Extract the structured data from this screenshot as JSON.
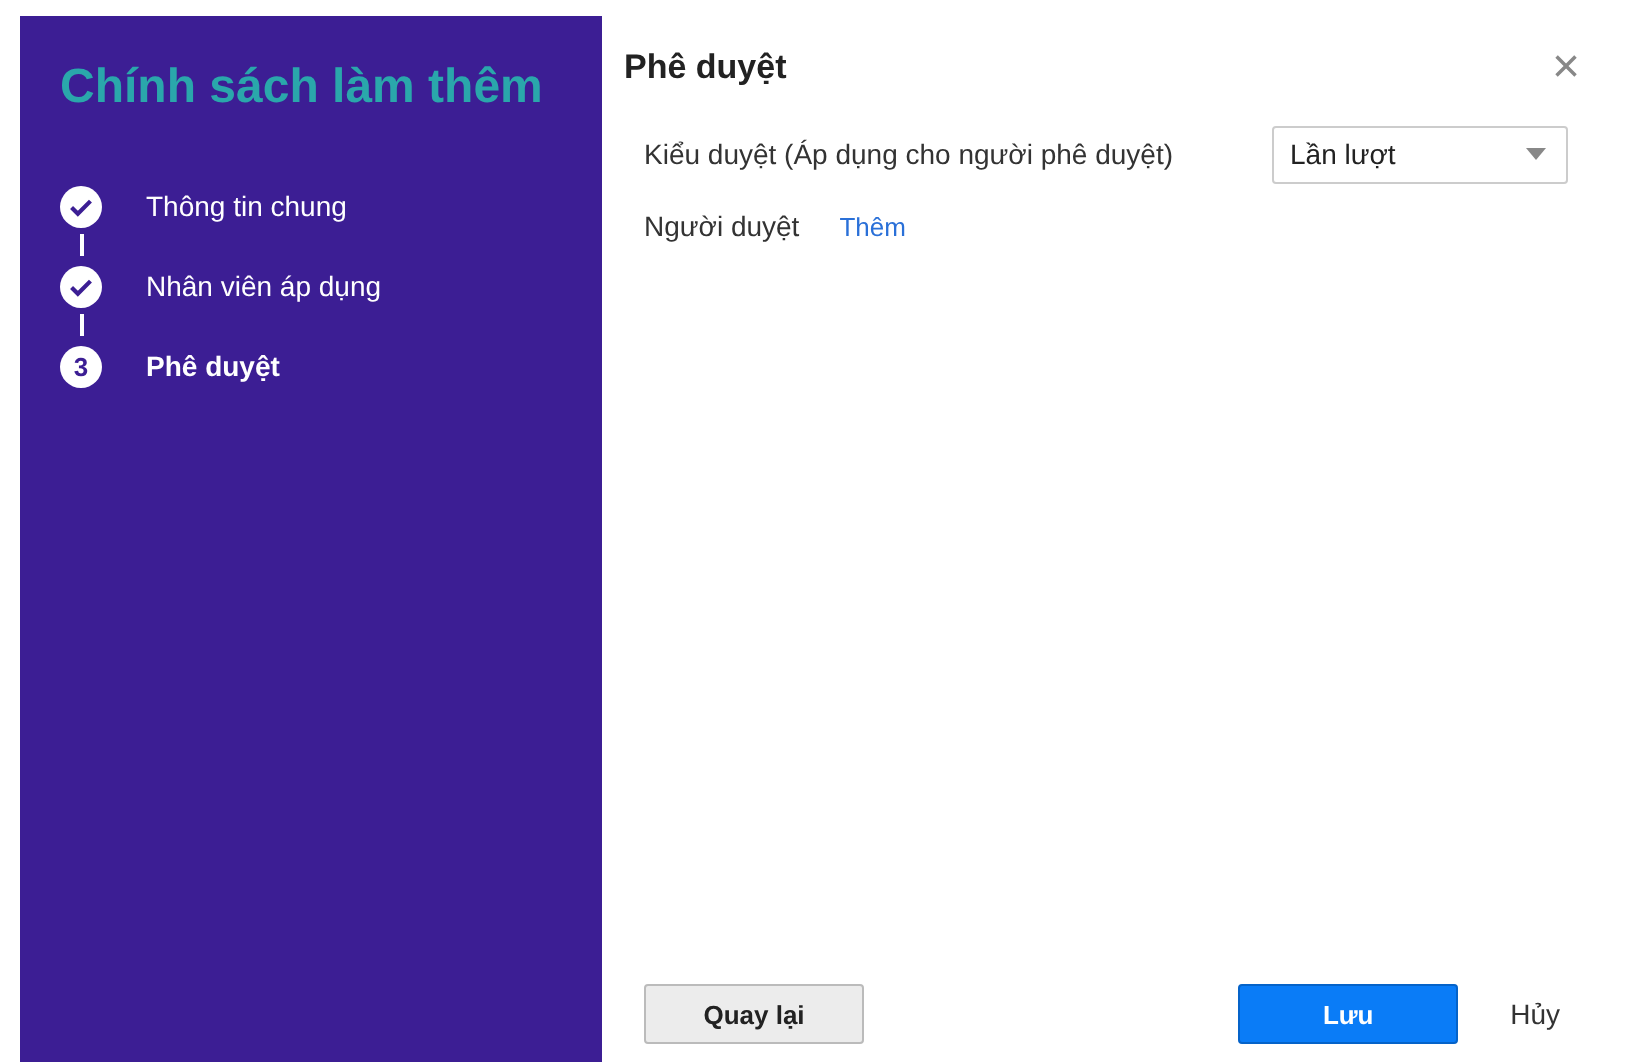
{
  "sidebar": {
    "title": "Chính sách làm thêm",
    "steps": [
      {
        "label": "Thông tin chung",
        "done": true,
        "selected": false
      },
      {
        "label": "Nhân viên áp dụng",
        "done": true,
        "selected": false
      },
      {
        "label": "Phê duyệt",
        "done": false,
        "selected": true,
        "number": "3"
      }
    ]
  },
  "dialog": {
    "title": "Phê duyệt",
    "close": "×",
    "fields": [
      {
        "kind": "select",
        "label": "Kiểu duyệt (Áp dụng cho người phê duyệt)",
        "value": "Lần lượt"
      },
      {
        "kind": "link",
        "label": "Người duyệt",
        "link": "Thêm"
      }
    ],
    "buttons": {
      "back": "Quay lại",
      "save": "Lưu",
      "cancel": "Hủy"
    }
  }
}
